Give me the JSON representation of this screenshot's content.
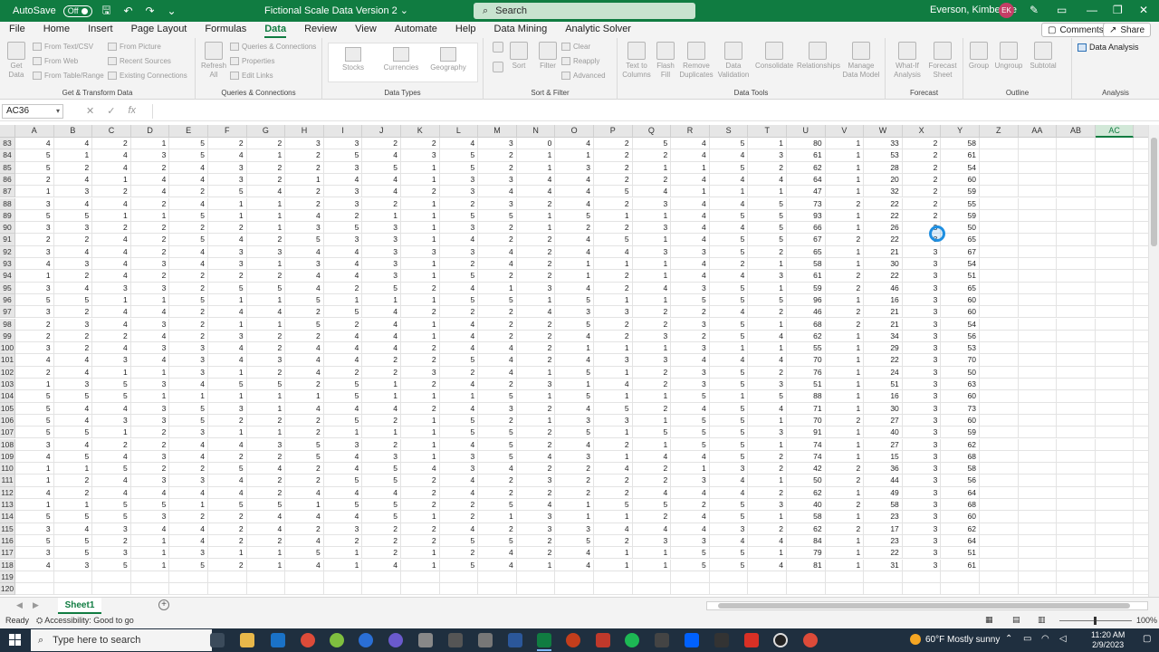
{
  "titlebar": {
    "autosave_label": "AutoSave",
    "autosave_state": "Off",
    "doc_title": "Fictional Scale Data Version 2",
    "search_placeholder": "Search",
    "user_name": "Everson, Kimberlee",
    "user_initials": "EK"
  },
  "menu": {
    "items": [
      "File",
      "Home",
      "Insert",
      "Page Layout",
      "Formulas",
      "Data",
      "Review",
      "View",
      "Automate",
      "Help",
      "Data Mining",
      "Analytic Solver"
    ],
    "active": "Data",
    "comments_label": "Comments",
    "share_label": "Share"
  },
  "ribbon": {
    "get_data": "Get Data",
    "from_text_csv": "From Text/CSV",
    "from_web": "From Web",
    "from_table_range": "From Table/Range",
    "from_picture": "From Picture",
    "recent_sources": "Recent Sources",
    "existing_connections": "Existing Connections",
    "group_get_transform": "Get & Transform Data",
    "refresh_all": "Refresh All",
    "queries_connections": "Queries & Connections",
    "properties": "Properties",
    "edit_links": "Edit Links",
    "group_queries": "Queries & Connections",
    "stocks": "Stocks",
    "currencies": "Currencies",
    "geography": "Geography",
    "group_data_types": "Data Types",
    "sort": "Sort",
    "filter": "Filter",
    "clear": "Clear",
    "reapply": "Reapply",
    "advanced": "Advanced",
    "group_sort_filter": "Sort & Filter",
    "text_to_columns": "Text to Columns",
    "flash_fill": "Flash Fill",
    "remove_duplicates": "Remove Duplicates",
    "data_validation": "Data Validation",
    "consolidate": "Consolidate",
    "relationships": "Relationships",
    "manage_data_model": "Manage Data Model",
    "group_data_tools": "Data Tools",
    "what_if": "What-If Analysis",
    "forecast_sheet": "Forecast Sheet",
    "group_forecast": "Forecast",
    "group": "Group",
    "ungroup": "Ungroup",
    "subtotal": "Subtotal",
    "group_outline": "Outline",
    "data_analysis": "Data Analysis",
    "group_analysis": "Analysis"
  },
  "formula_bar": {
    "name_box": "AC36",
    "cancel_icon": "✕",
    "enter_icon": "✓",
    "fx_label": "fx",
    "formula": ""
  },
  "grid": {
    "columns": [
      "A",
      "B",
      "C",
      "D",
      "E",
      "F",
      "G",
      "H",
      "I",
      "J",
      "K",
      "L",
      "M",
      "N",
      "O",
      "P",
      "Q",
      "R",
      "S",
      "T",
      "U",
      "V",
      "W",
      "X",
      "Y",
      "Z",
      "AA",
      "AB",
      "AC"
    ],
    "selected_column": "AC",
    "rows": [
      {
        "n": "83",
        "v": [
          4,
          4,
          2,
          1,
          5,
          2,
          2,
          3,
          3,
          2,
          2,
          4,
          3,
          0,
          4,
          2,
          5,
          4,
          5,
          1,
          80,
          1,
          33,
          2,
          58
        ]
      },
      {
        "n": "84",
        "v": [
          5,
          1,
          4,
          3,
          5,
          4,
          1,
          2,
          5,
          4,
          3,
          5,
          2,
          1,
          1,
          2,
          2,
          4,
          4,
          3,
          61,
          1,
          53,
          2,
          61
        ]
      },
      {
        "n": "85",
        "v": [
          5,
          2,
          4,
          2,
          4,
          3,
          2,
          2,
          3,
          5,
          1,
          5,
          2,
          1,
          3,
          2,
          1,
          1,
          5,
          2,
          62,
          1,
          28,
          2,
          54
        ]
      },
      {
        "n": "86",
        "v": [
          2,
          4,
          1,
          4,
          4,
          3,
          2,
          1,
          4,
          4,
          1,
          3,
          3,
          4,
          4,
          2,
          2,
          4,
          4,
          4,
          64,
          1,
          20,
          2,
          60
        ]
      },
      {
        "n": "87",
        "v": [
          1,
          3,
          2,
          4,
          2,
          5,
          4,
          2,
          3,
          4,
          2,
          3,
          4,
          4,
          4,
          5,
          4,
          1,
          1,
          1,
          47,
          1,
          32,
          2,
          59
        ]
      },
      {
        "n": "88",
        "v": [
          3,
          4,
          4,
          2,
          4,
          1,
          1,
          2,
          3,
          2,
          1,
          2,
          3,
          2,
          4,
          2,
          3,
          4,
          4,
          5,
          73,
          2,
          22,
          2,
          55
        ]
      },
      {
        "n": "89",
        "v": [
          5,
          5,
          1,
          1,
          5,
          1,
          1,
          4,
          2,
          1,
          1,
          5,
          5,
          1,
          5,
          1,
          1,
          4,
          5,
          5,
          93,
          1,
          22,
          2,
          59
        ]
      },
      {
        "n": "90",
        "v": [
          3,
          3,
          2,
          2,
          2,
          2,
          1,
          3,
          5,
          3,
          1,
          3,
          2,
          1,
          2,
          2,
          3,
          4,
          4,
          5,
          66,
          1,
          26,
          3,
          50
        ]
      },
      {
        "n": "91",
        "v": [
          2,
          2,
          4,
          2,
          5,
          4,
          2,
          5,
          3,
          3,
          1,
          4,
          2,
          2,
          4,
          5,
          1,
          4,
          5,
          5,
          67,
          2,
          22,
          3,
          65
        ]
      },
      {
        "n": "92",
        "v": [
          3,
          4,
          4,
          2,
          4,
          3,
          3,
          4,
          4,
          3,
          3,
          3,
          4,
          2,
          4,
          4,
          3,
          3,
          5,
          2,
          65,
          1,
          21,
          3,
          67
        ]
      },
      {
        "n": "93",
        "v": [
          4,
          3,
          4,
          3,
          4,
          3,
          1,
          3,
          4,
          3,
          1,
          2,
          4,
          2,
          1,
          1,
          1,
          4,
          2,
          1,
          58,
          1,
          30,
          3,
          54
        ]
      },
      {
        "n": "94",
        "v": [
          1,
          2,
          4,
          2,
          2,
          2,
          2,
          4,
          4,
          3,
          1,
          5,
          2,
          2,
          1,
          2,
          1,
          4,
          4,
          3,
          61,
          2,
          22,
          3,
          51
        ]
      },
      {
        "n": "95",
        "v": [
          3,
          4,
          3,
          3,
          2,
          5,
          5,
          4,
          2,
          5,
          2,
          4,
          1,
          3,
          4,
          2,
          4,
          3,
          5,
          1,
          59,
          2,
          46,
          3,
          65
        ]
      },
      {
        "n": "96",
        "v": [
          5,
          5,
          1,
          1,
          5,
          1,
          1,
          5,
          1,
          1,
          1,
          5,
          5,
          1,
          5,
          1,
          1,
          5,
          5,
          5,
          96,
          1,
          16,
          3,
          60
        ]
      },
      {
        "n": "97",
        "v": [
          3,
          2,
          4,
          4,
          2,
          4,
          4,
          2,
          5,
          4,
          2,
          2,
          2,
          4,
          3,
          3,
          2,
          2,
          4,
          2,
          46,
          2,
          21,
          3,
          60
        ]
      },
      {
        "n": "98",
        "v": [
          2,
          3,
          4,
          3,
          2,
          1,
          1,
          5,
          2,
          4,
          1,
          4,
          2,
          2,
          5,
          2,
          2,
          3,
          5,
          1,
          68,
          2,
          21,
          3,
          54
        ]
      },
      {
        "n": "99",
        "v": [
          2,
          2,
          2,
          4,
          2,
          3,
          2,
          2,
          4,
          4,
          1,
          4,
          2,
          2,
          4,
          2,
          3,
          2,
          5,
          4,
          62,
          1,
          34,
          3,
          56
        ]
      },
      {
        "n": "100",
        "v": [
          3,
          2,
          4,
          3,
          3,
          4,
          2,
          4,
          4,
          4,
          2,
          4,
          4,
          2,
          1,
          1,
          1,
          3,
          1,
          1,
          55,
          1,
          29,
          3,
          53
        ]
      },
      {
        "n": "101",
        "v": [
          4,
          4,
          3,
          4,
          3,
          4,
          3,
          4,
          4,
          2,
          2,
          5,
          4,
          2,
          4,
          3,
          3,
          4,
          4,
          4,
          70,
          1,
          22,
          3,
          70
        ]
      },
      {
        "n": "102",
        "v": [
          2,
          4,
          1,
          1,
          3,
          1,
          2,
          4,
          2,
          2,
          3,
          2,
          4,
          1,
          5,
          1,
          2,
          3,
          5,
          2,
          76,
          1,
          24,
          3,
          50
        ]
      },
      {
        "n": "103",
        "v": [
          1,
          3,
          5,
          3,
          4,
          5,
          5,
          2,
          5,
          1,
          2,
          4,
          2,
          3,
          1,
          4,
          2,
          3,
          5,
          3,
          51,
          1,
          51,
          3,
          63
        ]
      },
      {
        "n": "104",
        "v": [
          5,
          5,
          5,
          1,
          1,
          1,
          1,
          1,
          5,
          1,
          1,
          1,
          5,
          1,
          5,
          1,
          1,
          5,
          1,
          5,
          88,
          1,
          16,
          3,
          60
        ]
      },
      {
        "n": "105",
        "v": [
          5,
          4,
          4,
          3,
          5,
          3,
          1,
          4,
          4,
          4,
          2,
          4,
          3,
          2,
          4,
          5,
          2,
          4,
          5,
          4,
          71,
          1,
          30,
          3,
          73
        ]
      },
      {
        "n": "106",
        "v": [
          5,
          4,
          3,
          3,
          5,
          2,
          2,
          2,
          5,
          2,
          1,
          5,
          2,
          1,
          3,
          3,
          1,
          5,
          5,
          1,
          70,
          2,
          27,
          3,
          60
        ]
      },
      {
        "n": "107",
        "v": [
          5,
          5,
          1,
          2,
          3,
          1,
          1,
          2,
          1,
          1,
          1,
          5,
          5,
          2,
          5,
          1,
          5,
          5,
          5,
          3,
          91,
          1,
          40,
          3,
          59
        ]
      },
      {
        "n": "108",
        "v": [
          3,
          4,
          2,
          2,
          4,
          4,
          3,
          5,
          3,
          2,
          1,
          4,
          5,
          2,
          4,
          2,
          1,
          5,
          5,
          1,
          74,
          1,
          27,
          3,
          62
        ]
      },
      {
        "n": "109",
        "v": [
          4,
          5,
          4,
          3,
          4,
          2,
          2,
          5,
          4,
          3,
          1,
          3,
          5,
          4,
          3,
          1,
          4,
          4,
          5,
          2,
          74,
          1,
          15,
          3,
          68
        ]
      },
      {
        "n": "110",
        "v": [
          1,
          1,
          5,
          2,
          2,
          5,
          4,
          2,
          4,
          5,
          4,
          3,
          4,
          2,
          2,
          4,
          2,
          1,
          3,
          2,
          42,
          2,
          36,
          3,
          58
        ]
      },
      {
        "n": "111",
        "v": [
          1,
          2,
          4,
          3,
          3,
          4,
          2,
          2,
          5,
          5,
          2,
          4,
          2,
          3,
          2,
          2,
          2,
          3,
          4,
          1,
          50,
          2,
          44,
          3,
          56
        ]
      },
      {
        "n": "112",
        "v": [
          4,
          2,
          4,
          4,
          4,
          4,
          2,
          4,
          4,
          4,
          2,
          4,
          2,
          2,
          2,
          2,
          4,
          4,
          4,
          2,
          62,
          1,
          49,
          3,
          64
        ]
      },
      {
        "n": "113",
        "v": [
          1,
          1,
          5,
          5,
          1,
          5,
          5,
          1,
          5,
          5,
          2,
          2,
          5,
          4,
          1,
          5,
          5,
          2,
          5,
          3,
          40,
          2,
          58,
          3,
          68
        ]
      },
      {
        "n": "114",
        "v": [
          5,
          5,
          5,
          3,
          2,
          2,
          4,
          4,
          4,
          5,
          1,
          2,
          1,
          3,
          1,
          1,
          2,
          4,
          5,
          1,
          58,
          1,
          23,
          3,
          60
        ]
      },
      {
        "n": "115",
        "v": [
          3,
          4,
          3,
          4,
          4,
          2,
          4,
          2,
          3,
          2,
          2,
          4,
          2,
          3,
          3,
          4,
          4,
          4,
          3,
          2,
          62,
          2,
          17,
          3,
          62
        ]
      },
      {
        "n": "116",
        "v": [
          5,
          5,
          2,
          1,
          4,
          2,
          2,
          4,
          2,
          2,
          2,
          5,
          5,
          2,
          5,
          2,
          3,
          3,
          4,
          4,
          84,
          1,
          23,
          3,
          64
        ]
      },
      {
        "n": "117",
        "v": [
          3,
          5,
          3,
          1,
          3,
          1,
          1,
          5,
          1,
          2,
          1,
          2,
          4,
          2,
          4,
          1,
          1,
          5,
          5,
          1,
          79,
          1,
          22,
          3,
          51
        ]
      },
      {
        "n": "118",
        "v": [
          4,
          3,
          5,
          1,
          5,
          2,
          1,
          4,
          1,
          4,
          1,
          5,
          4,
          1,
          4,
          1,
          1,
          5,
          5,
          4,
          81,
          1,
          31,
          3,
          61
        ]
      },
      {
        "n": "119",
        "v": []
      },
      {
        "n": "120",
        "v": []
      }
    ]
  },
  "sheets": {
    "tabs": [
      "Sheet1"
    ],
    "active": "Sheet1"
  },
  "status": {
    "ready": "Ready",
    "accessibility": "Accessibility: Good to go",
    "zoom": "100%"
  },
  "taskbar": {
    "search_placeholder": "Type here to search",
    "weather": "60°F  Mostly sunny",
    "time": "11:20 AM",
    "date": "2/9/2023"
  }
}
